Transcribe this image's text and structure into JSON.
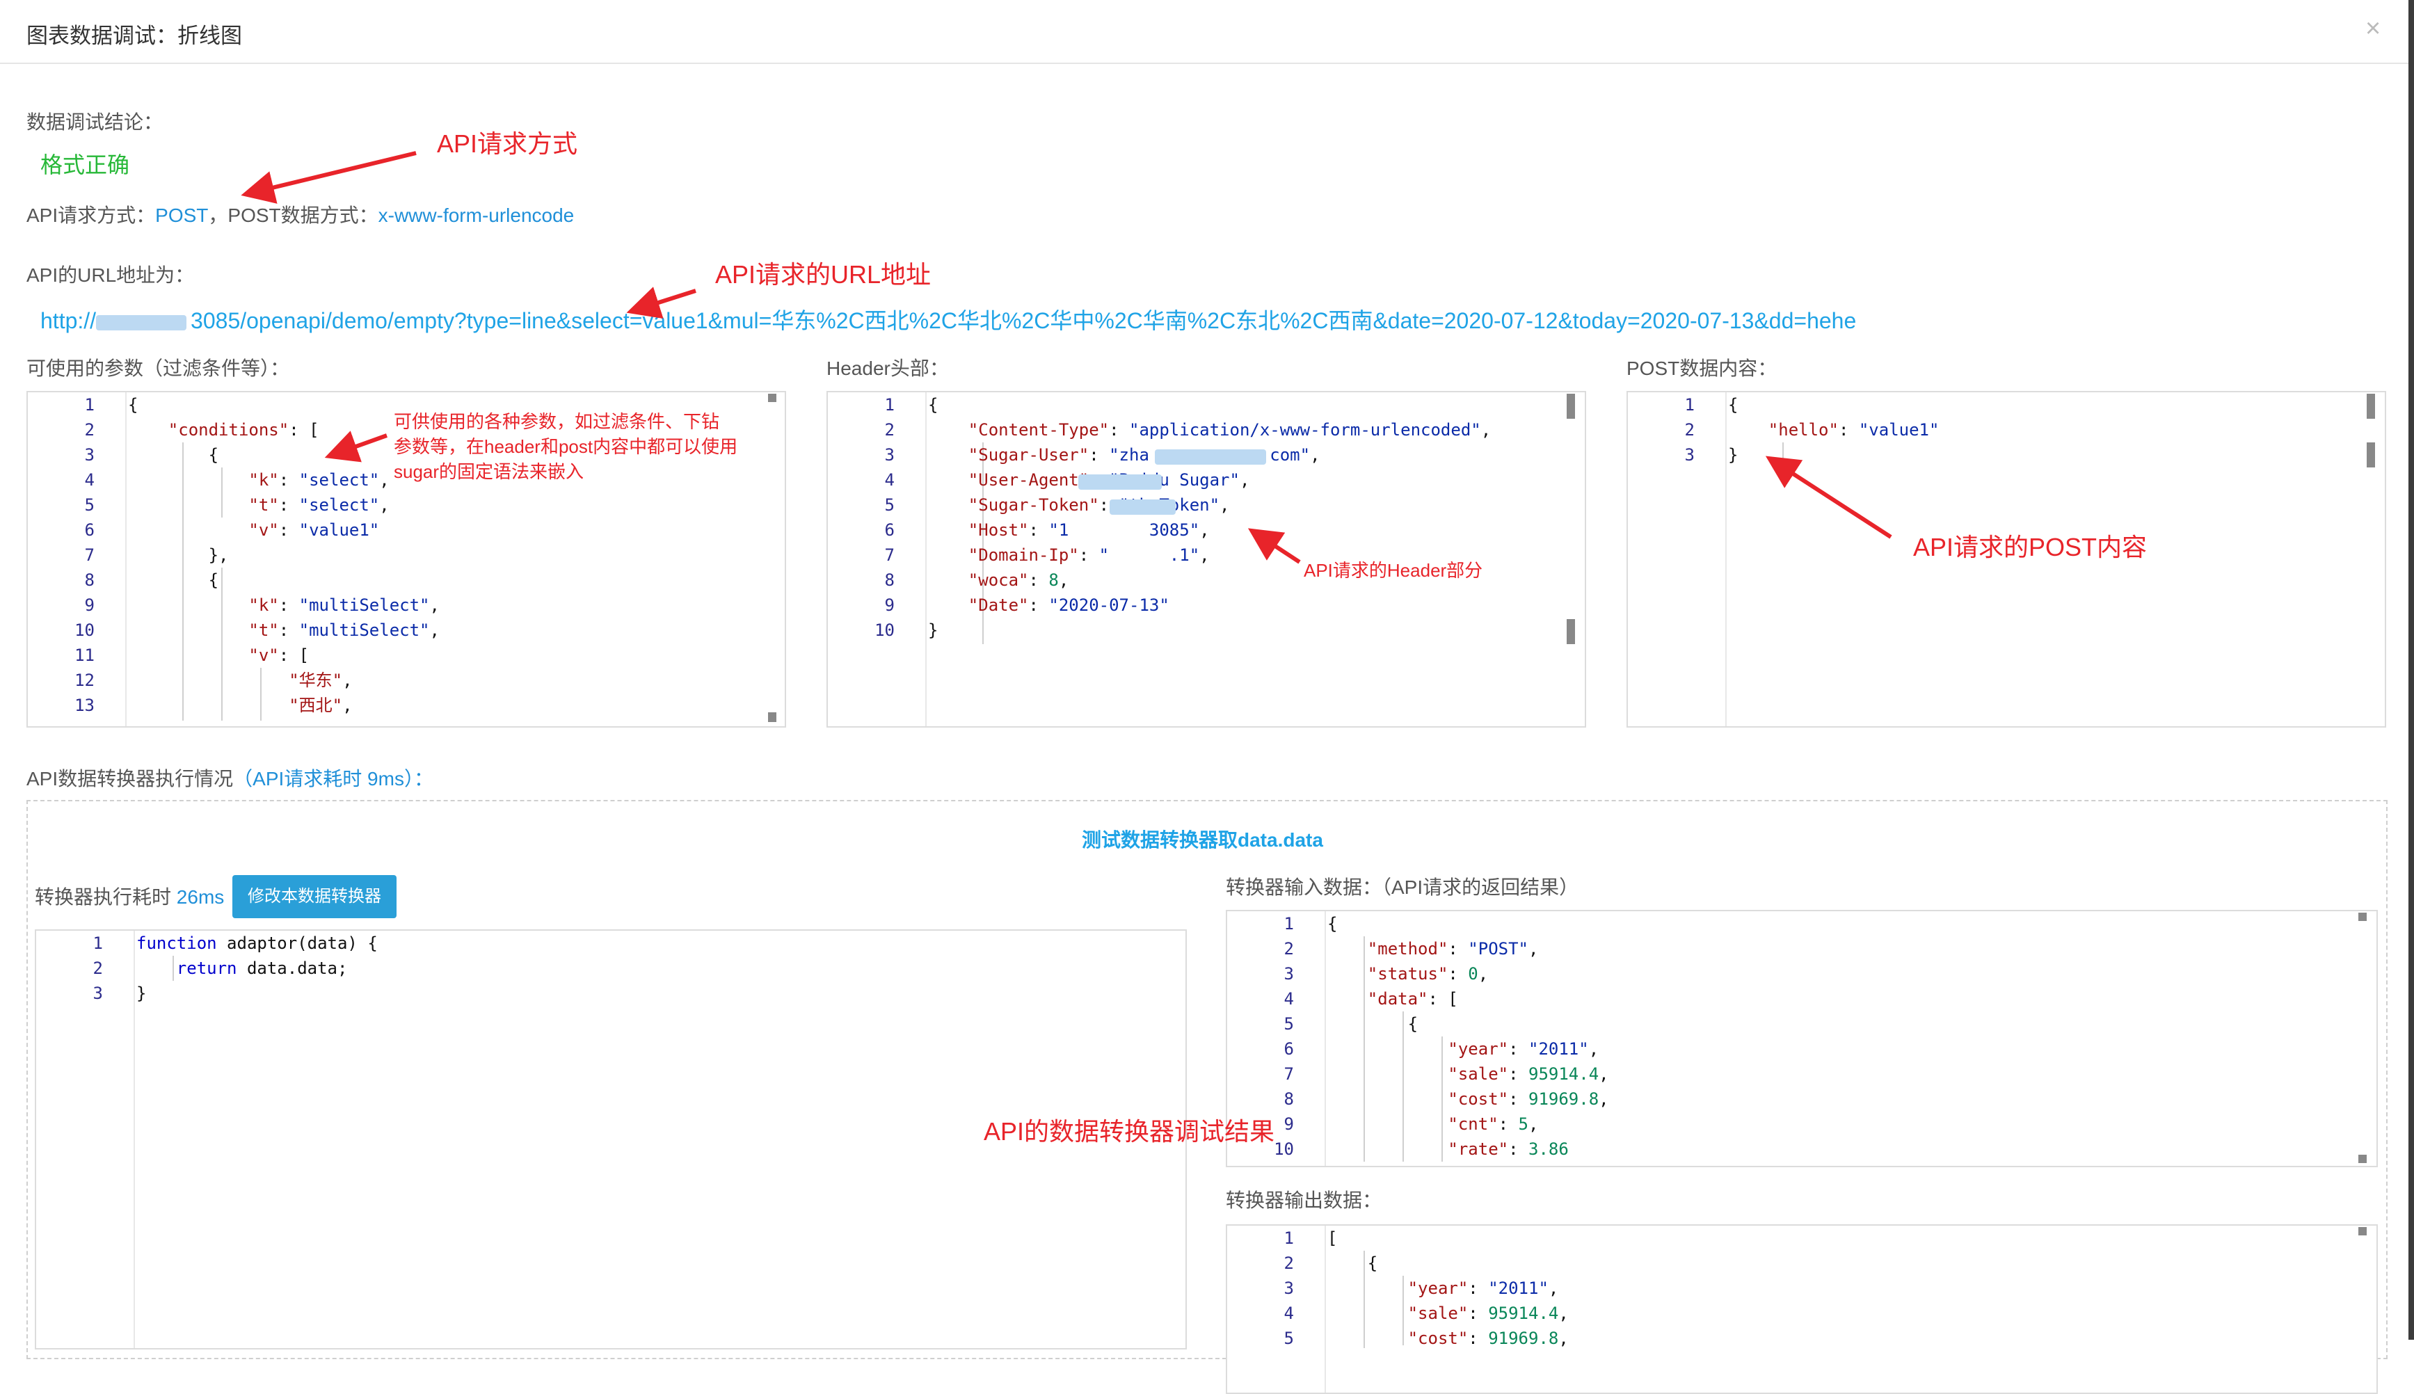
{
  "window": {
    "title": "图表数据调试：折线图",
    "close_symbol": "×"
  },
  "result": {
    "label": "数据调试结论：",
    "status": "格式正确"
  },
  "request": {
    "label": "API请求方式：",
    "method": "POST",
    "post_label": "POST数据方式：",
    "post_type": "x-www-form-urlencode",
    "separator": "，"
  },
  "url": {
    "label": "API的URL地址为：",
    "prefix": "http://",
    "value": "3085/openapi/demo/empty?type=line&select=value1&mul=华东%2C西北%2C华北%2C华中%2C华南%2C东北%2C西南&date=2020-07-12&today=2020-07-13&dd=hehe"
  },
  "params": {
    "label": "可使用的参数（过滤条件等）：",
    "lines": [
      {
        "n": "1",
        "t": "{"
      },
      {
        "n": "2",
        "t": "    \"conditions\": ["
      },
      {
        "n": "3",
        "t": "        {"
      },
      {
        "n": "4",
        "t": "            \"k\": \"select\","
      },
      {
        "n": "5",
        "t": "            \"t\": \"select\","
      },
      {
        "n": "6",
        "t": "            \"v\": \"value1\""
      },
      {
        "n": "7",
        "t": "        },"
      },
      {
        "n": "8",
        "t": "        {"
      },
      {
        "n": "9",
        "t": "            \"k\": \"multiSelect\","
      },
      {
        "n": "10",
        "t": "            \"t\": \"multiSelect\","
      },
      {
        "n": "11",
        "t": "            \"v\": ["
      },
      {
        "n": "12",
        "t": "                \"华东\","
      },
      {
        "n": "13",
        "t": "                \"西北\","
      }
    ]
  },
  "headers": {
    "label": "Header头部：",
    "lines": [
      {
        "n": "1",
        "t": "{"
      },
      {
        "n": "2",
        "t": "    \"Content-Type\": \"application/x-www-form-urlencoded\","
      },
      {
        "n": "3",
        "t": "    \"Sugar-User\": \"zha          u.com\","
      },
      {
        "n": "4",
        "t": "    \"User-Agent\": \"Baidu Sugar\","
      },
      {
        "n": "5",
        "t": "    \"Sugar-Token\": \"theToken\","
      },
      {
        "n": "6",
        "t": "    \"Host\": \"1        3085\","
      },
      {
        "n": "7",
        "t": "    \"Domain-Ip\": \"      .1\","
      },
      {
        "n": "8",
        "t": "    \"woca\": 8,"
      },
      {
        "n": "9",
        "t": "    \"Date\": \"2020-07-13\""
      },
      {
        "n": "10",
        "t": "}"
      }
    ]
  },
  "post": {
    "label": "POST数据内容：",
    "lines": [
      {
        "n": "1",
        "t": "{"
      },
      {
        "n": "2",
        "t": "    \"hello\": \"value1\""
      },
      {
        "n": "3",
        "t": "}"
      }
    ]
  },
  "converter": {
    "label": "API数据转换器执行情况",
    "timing": "（API请求耗时 9ms）：",
    "test_title": "测试数据转换器取data.data",
    "exec_label": "转换器执行耗时",
    "exec_time": "26ms",
    "modify_button": "修改本数据转换器",
    "code_lines": [
      {
        "n": "1",
        "t": "function adaptor(data) {"
      },
      {
        "n": "2",
        "t": "    return data.data;"
      },
      {
        "n": "3",
        "t": "}"
      }
    ],
    "input_label": "转换器输入数据：（API请求的返回结果）",
    "input_lines": [
      {
        "n": "1",
        "t": "{"
      },
      {
        "n": "2",
        "t": "    \"method\": \"POST\","
      },
      {
        "n": "3",
        "t": "    \"status\": 0,"
      },
      {
        "n": "4",
        "t": "    \"data\": ["
      },
      {
        "n": "5",
        "t": "        {"
      },
      {
        "n": "6",
        "t": "            \"year\": \"2011\","
      },
      {
        "n": "7",
        "t": "            \"sale\": 95914.4,"
      },
      {
        "n": "8",
        "t": "            \"cost\": 91969.8,"
      },
      {
        "n": "9",
        "t": "            \"cnt\": 5,"
      },
      {
        "n": "10",
        "t": "            \"rate\": 3.86"
      }
    ],
    "output_label": "转换器输出数据：",
    "output_lines": [
      {
        "n": "1",
        "t": "["
      },
      {
        "n": "2",
        "t": "    {"
      },
      {
        "n": "3",
        "t": "        \"year\": \"2011\","
      },
      {
        "n": "4",
        "t": "        \"sale\": 95914.4,"
      },
      {
        "n": "5",
        "t": "        \"cost\": 91969.8,"
      }
    ]
  },
  "annotations": {
    "method": "API请求方式",
    "url": "API请求的URL地址",
    "params": [
      "可供使用的各种参数，如过滤条件、下钻",
      "参数等，在header和post内容中都可以使用",
      "sugar的固定语法来嵌入"
    ],
    "header": "API请求的Header部分",
    "post": "API请求的POST内容",
    "converter": "API的数据转换器调试结果"
  },
  "colors": {
    "status_green": "#27b838",
    "link_blue": "#1fa3e6",
    "button_blue": "#2a9fd8",
    "annotation_red": "#e8242a"
  }
}
